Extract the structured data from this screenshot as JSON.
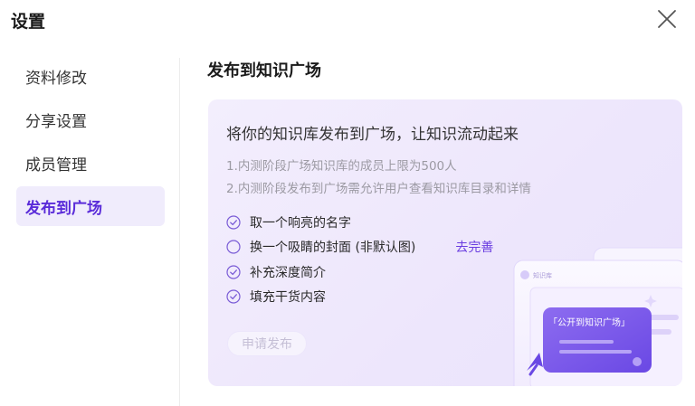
{
  "dialog": {
    "title": "设置"
  },
  "sidebar": {
    "items": [
      {
        "label": "资料修改",
        "active": false
      },
      {
        "label": "分享设置",
        "active": false
      },
      {
        "label": "成员管理",
        "active": false
      },
      {
        "label": "发布到广场",
        "active": true
      }
    ]
  },
  "main": {
    "title": "发布到知识广场",
    "card": {
      "heading": "将你的知识库发布到广场，让知识流动起来",
      "notes": [
        "1.内测阶段广场知识库的成员上限为500人",
        "2.内测阶段发布到广场需允许用户查看知识库目录和详情"
      ],
      "checklist": [
        {
          "label": "取一个响亮的名字",
          "done": true,
          "icon": "check-circle-icon"
        },
        {
          "label": "换一个吸睛的封面 (非默认图)",
          "done": false,
          "icon": "empty-circle-icon",
          "action": "去完善"
        },
        {
          "label": "补充深度简介",
          "done": true,
          "icon": "check-circle-icon"
        },
        {
          "label": "填充干货内容",
          "done": true,
          "icon": "check-circle-icon"
        }
      ],
      "publish_button": "申请发布",
      "illustration": {
        "window_label": "知识库",
        "badge_text": "「公开到知识广场」"
      }
    }
  },
  "colors": {
    "accent": "#5a2bd9",
    "link": "#6a3de0",
    "card_bg": "#efe8fc",
    "disabled_text": "#c5bfd6"
  }
}
